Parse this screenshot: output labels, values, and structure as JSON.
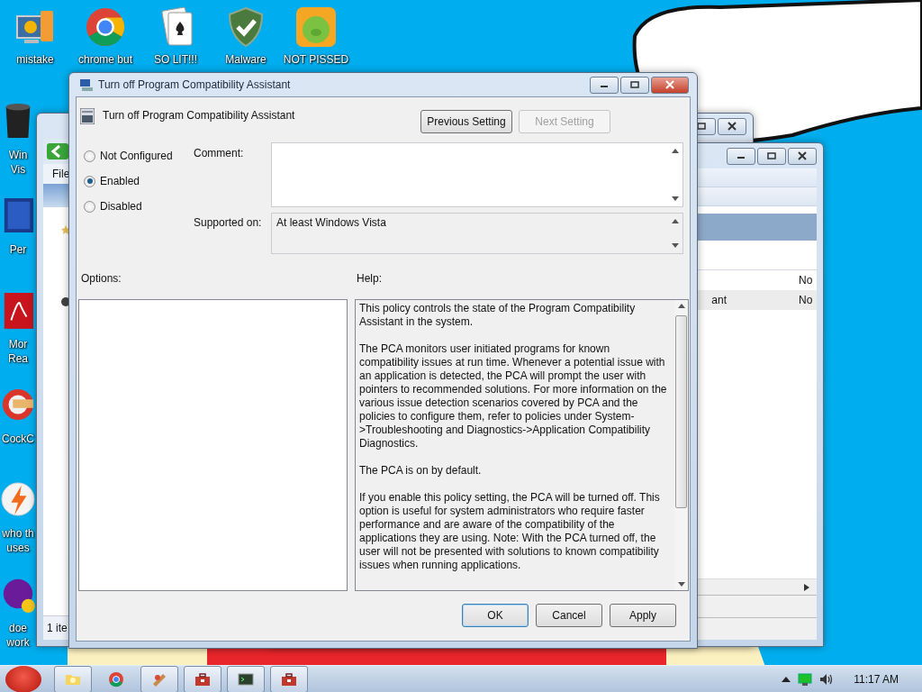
{
  "desktop_icons": [
    {
      "label": "mistake",
      "kind": "computer"
    },
    {
      "label": "chrome but",
      "kind": "chrome"
    },
    {
      "label": "SO LIT!!!",
      "kind": "cards"
    },
    {
      "label": "Malware",
      "kind": "shield"
    },
    {
      "label": "NOT PISSED",
      "kind": "game"
    }
  ],
  "side_icons": [
    {
      "lines": [
        "Win",
        "Vis"
      ],
      "kind": "media"
    },
    {
      "lines": [
        "Per"
      ],
      "kind": "document"
    },
    {
      "lines": [
        "Mor",
        "Rea"
      ],
      "kind": "pdf"
    },
    {
      "lines": [
        "CockC"
      ],
      "kind": "cleaner"
    },
    {
      "lines": [
        "who th",
        "uses"
      ],
      "kind": "bolt"
    },
    {
      "lines": [
        "doe",
        "work"
      ],
      "kind": "yahoo"
    }
  ],
  "back_window": {
    "menu": "File",
    "status": "1 ite"
  },
  "list_window": {
    "rows": [
      {
        "column_2": "No",
        "selected": false
      },
      {
        "column_1": "ant",
        "column_2": "No",
        "selected": true
      }
    ]
  },
  "dialog": {
    "title": "Turn off Program Compatibility Assistant",
    "heading": "Turn off Program Compatibility Assistant",
    "nav_buttons": [
      {
        "label": "Previous Setting",
        "disabled": false
      },
      {
        "label": "Next Setting",
        "disabled": true
      }
    ],
    "states": [
      {
        "label": "Not Configured",
        "selected": false
      },
      {
        "label": "Enabled",
        "selected": true
      },
      {
        "label": "Disabled",
        "selected": false
      }
    ],
    "comment_label": "Comment:",
    "supported_label": "Supported on:",
    "supported_value": "At least Windows Vista",
    "options_label": "Options:",
    "help_label": "Help:",
    "help": [
      "This policy controls the state of the Program Compatibility Assistant in the system.",
      "The PCA monitors user initiated programs for known compatibility issues at run time. Whenever a potential issue with an application is detected, the PCA will prompt the user with pointers to recommended solutions.  For more information on the various issue detection scenarios covered by PCA and the policies to configure them, refer to policies under System->Troubleshooting and Diagnostics->Application Compatibility Diagnostics.",
      "The PCA is on by default.",
      "If you enable this policy setting, the PCA will be turned off. This option is useful for system administrators who require faster performance and are aware of the compatibility of the applications they are using. Note: With the PCA turned off, the user will not be presented with solutions to known compatibility issues when running applications."
    ],
    "buttons": [
      {
        "label": "OK",
        "focused": true
      },
      {
        "label": "Cancel",
        "focused": false
      },
      {
        "label": "Apply",
        "focused": false
      }
    ]
  },
  "taskbar": {
    "buttons": [
      {
        "kind": "folder",
        "running": true
      },
      {
        "kind": "chrome",
        "running": false
      },
      {
        "kind": "paint",
        "running": true
      },
      {
        "kind": "toolbox",
        "running": true
      },
      {
        "kind": "terminal",
        "running": true
      },
      {
        "kind": "toolbox",
        "running": true
      }
    ],
    "clock": "11:17 AM"
  }
}
